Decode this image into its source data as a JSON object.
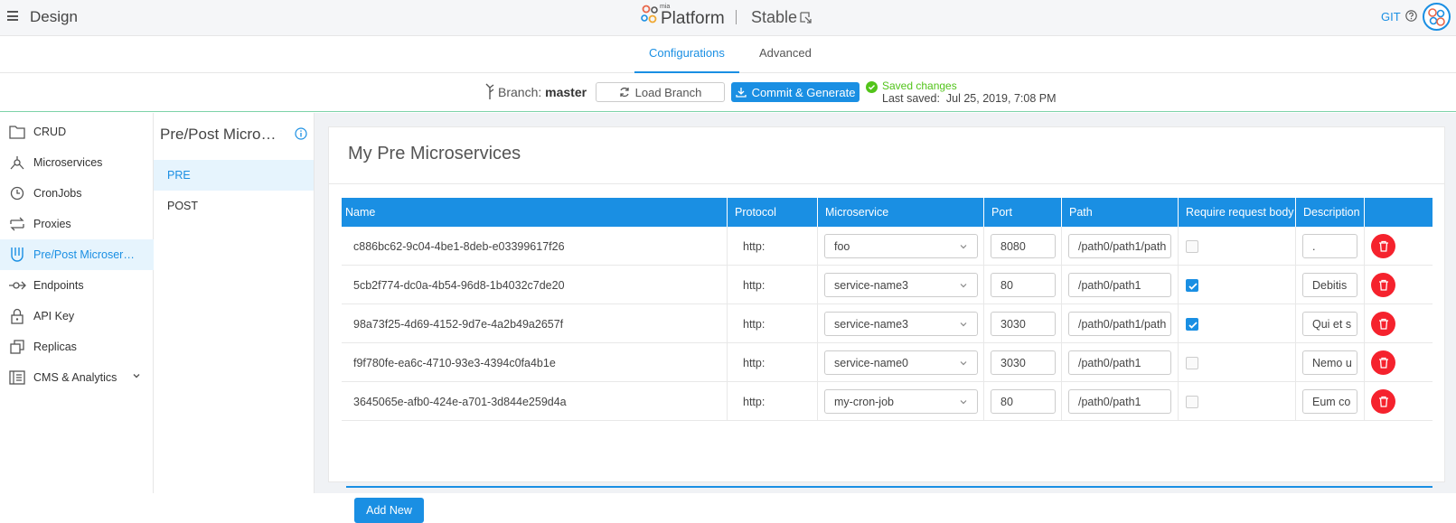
{
  "header": {
    "app_title": "Design",
    "brand_prefix": "mia",
    "brand_name": "Platform",
    "environment": "Stable",
    "git_label": "GIT"
  },
  "tabs": [
    {
      "label": "Configurations",
      "active": true
    },
    {
      "label": "Advanced",
      "active": false
    }
  ],
  "branch": {
    "label": "Branch:",
    "name": "master",
    "load_button": "Load Branch",
    "commit_button": "Commit & Generate",
    "saved_status": "Saved changes",
    "last_saved_label": "Last saved:",
    "last_saved_value": "Jul 25, 2019, 7:08 PM"
  },
  "sidebar": {
    "items": [
      {
        "label": "CRUD",
        "icon": "folder-icon"
      },
      {
        "label": "Microservices",
        "icon": "microservices-icon"
      },
      {
        "label": "CronJobs",
        "icon": "cronjob-icon"
      },
      {
        "label": "Proxies",
        "icon": "proxy-icon"
      },
      {
        "label": "Pre/Post Microser…",
        "icon": "prepost-icon",
        "active": true
      },
      {
        "label": "Endpoints",
        "icon": "endpoint-icon"
      },
      {
        "label": "API Key",
        "icon": "lock-icon"
      },
      {
        "label": "Replicas",
        "icon": "replicas-icon"
      },
      {
        "label": "CMS & Analytics",
        "icon": "cms-icon"
      }
    ]
  },
  "subpanel": {
    "title": "Pre/Post Micro…",
    "items": [
      {
        "label": "PRE",
        "active": true
      },
      {
        "label": "POST",
        "active": false
      }
    ]
  },
  "main": {
    "title": "My Pre Microservices",
    "columns": [
      "Name",
      "Protocol",
      "Microservice",
      "Port",
      "Path",
      "Require request body",
      "Description"
    ],
    "rows": [
      {
        "name": "c886bc62-9c04-4be1-8deb-e03399617f26",
        "protocol": "http:",
        "microservice": "foo",
        "port": "8080",
        "path": "/path0/path1/path",
        "require_body": false,
        "description": "."
      },
      {
        "name": "5cb2f774-dc0a-4b54-96d8-1b4032c7de20",
        "protocol": "http:",
        "microservice": "service-name3",
        "port": "80",
        "path": "/path0/path1",
        "require_body": true,
        "description": "Debitis"
      },
      {
        "name": "98a73f25-4d69-4152-9d7e-4a2b49a2657f",
        "protocol": "http:",
        "microservice": "service-name3",
        "port": "3030",
        "path": "/path0/path1/path",
        "require_body": true,
        "description": "Qui et s"
      },
      {
        "name": "f9f780fe-ea6c-4710-93e3-4394c0fa4b1e",
        "protocol": "http:",
        "microservice": "service-name0",
        "port": "3030",
        "path": "/path0/path1",
        "require_body": false,
        "description": "Nemo u"
      },
      {
        "name": "3645065e-afb0-424e-a701-3d844e259d4a",
        "protocol": "http:",
        "microservice": "my-cron-job",
        "port": "80",
        "path": "/path0/path1",
        "require_body": false,
        "description": "Eum co"
      }
    ],
    "add_button": "Add New"
  },
  "colors": {
    "accent": "#1a8fe3",
    "success": "#52c41a",
    "danger": "#f5222d",
    "active_bg": "#e6f4fd"
  }
}
